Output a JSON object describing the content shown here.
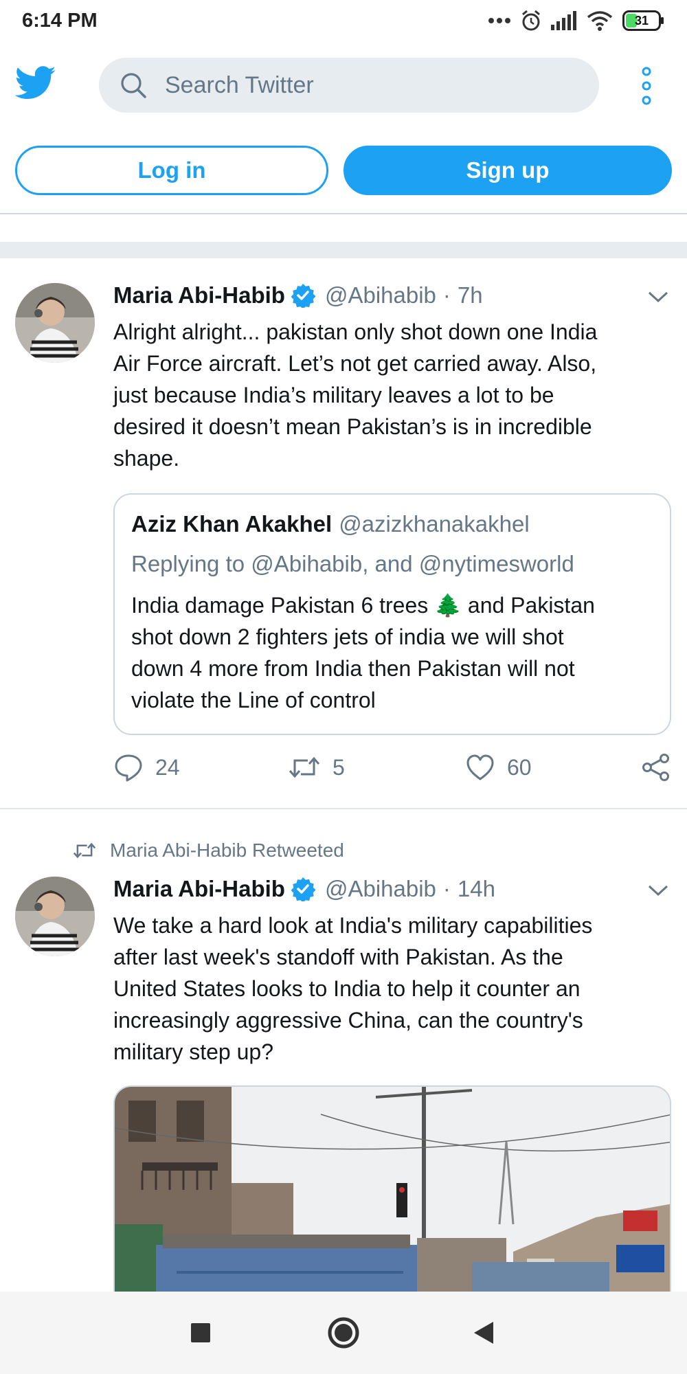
{
  "status_bar": {
    "time": "6:14 PM",
    "battery": "31"
  },
  "header": {
    "search_placeholder": "Search Twitter",
    "login_label": "Log in",
    "signup_label": "Sign up"
  },
  "tweets": [
    {
      "name": "Maria Abi-Habib",
      "handle": "@Abihabib",
      "dot": "·",
      "time": "7h",
      "lines": [
        "Alright alright... pakistan only shot down one India",
        "Air Force aircraft. Let’s not get carried away. Also,",
        "just because India’s military leaves a lot to be",
        "desired it doesn’t mean Pakistan’s is in incredible",
        "shape."
      ],
      "quote": {
        "name": "Aziz Khan Akakhel",
        "handle": "@azizkhanakakhel",
        "replying": "Replying to @Abihabib, and @nytimesworld",
        "lines": [
          "India damage Pakistan 6 trees 🌲 and Pakistan",
          "shot down 2 fighters jets of india we will shot",
          "down 4 more from India then Pakistan will not",
          "violate the Line of control"
        ]
      },
      "replies": "24",
      "retweets": "5",
      "likes": "60"
    },
    {
      "retweeted_by": "Maria Abi-Habib Retweeted",
      "name": "Maria Abi-Habib",
      "handle": "@Abihabib",
      "dot": "·",
      "time": "14h",
      "lines": [
        "We take a hard look at India's military capabilities",
        "after last week's standoff with Pakistan. As the",
        "United States looks to India to help it counter an",
        "increasingly aggressive China, can the country's",
        "military step up?"
      ]
    }
  ],
  "icons": {
    "logo": "twitter-bird-icon",
    "search": "search-icon",
    "more": "more-vertical-icon",
    "verified": "verified-badge-icon",
    "caret": "chevron-down-icon",
    "reply": "reply-icon",
    "retweet": "retweet-icon",
    "like": "heart-icon",
    "share": "share-icon",
    "nav_recents": "square-icon",
    "nav_home": "circle-icon",
    "nav_back": "back-triangle-icon"
  },
  "colors": {
    "accent": "#1da1f2",
    "secondary_text": "#657786",
    "border": "#ccd6dd",
    "search_bg": "#e6ecf0"
  }
}
